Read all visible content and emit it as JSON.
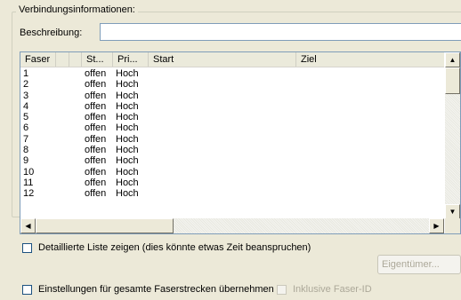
{
  "group": {
    "title": "Verbindungsinformationen:"
  },
  "description": {
    "label": "Beschreibung:",
    "value": ""
  },
  "table": {
    "columns": [
      "Faser",
      "",
      "St...",
      "Pri...",
      "Start",
      "Ziel"
    ],
    "rows": [
      {
        "faser": "1",
        "status": "offen",
        "prio": "Hoch"
      },
      {
        "faser": "2",
        "status": "offen",
        "prio": "Hoch"
      },
      {
        "faser": "3",
        "status": "offen",
        "prio": "Hoch"
      },
      {
        "faser": "4",
        "status": "offen",
        "prio": "Hoch"
      },
      {
        "faser": "5",
        "status": "offen",
        "prio": "Hoch"
      },
      {
        "faser": "6",
        "status": "offen",
        "prio": "Hoch"
      },
      {
        "faser": "7",
        "status": "offen",
        "prio": "Hoch"
      },
      {
        "faser": "8",
        "status": "offen",
        "prio": "Hoch"
      },
      {
        "faser": "9",
        "status": "offen",
        "prio": "Hoch"
      },
      {
        "faser": "10",
        "status": "offen",
        "prio": "Hoch"
      },
      {
        "faser": "11",
        "status": "offen",
        "prio": "Hoch"
      },
      {
        "faser": "12",
        "status": "offen",
        "prio": "Hoch"
      }
    ]
  },
  "detail_check": {
    "label": "Detaillierte Liste zeigen (dies könnte etwas Zeit beanspruchen)",
    "checked": false
  },
  "owner_button": {
    "label": "Eigentümer...",
    "enabled": false
  },
  "apply_check": {
    "label": "Einstellungen für gesamte Faserstrecken übernehmen",
    "checked": false
  },
  "fiber_id_check": {
    "label": "Inklusive Faser-ID",
    "checked": false,
    "enabled": false
  },
  "icons": {
    "scroll_up": "arrow-up-icon",
    "scroll_down": "arrow-down-icon",
    "scroll_left": "arrow-left-icon",
    "scroll_right": "arrow-right-icon"
  },
  "colors": {
    "background": "#ece9d8",
    "input_border": "#7f9db9",
    "disabled_text": "#aca899"
  }
}
